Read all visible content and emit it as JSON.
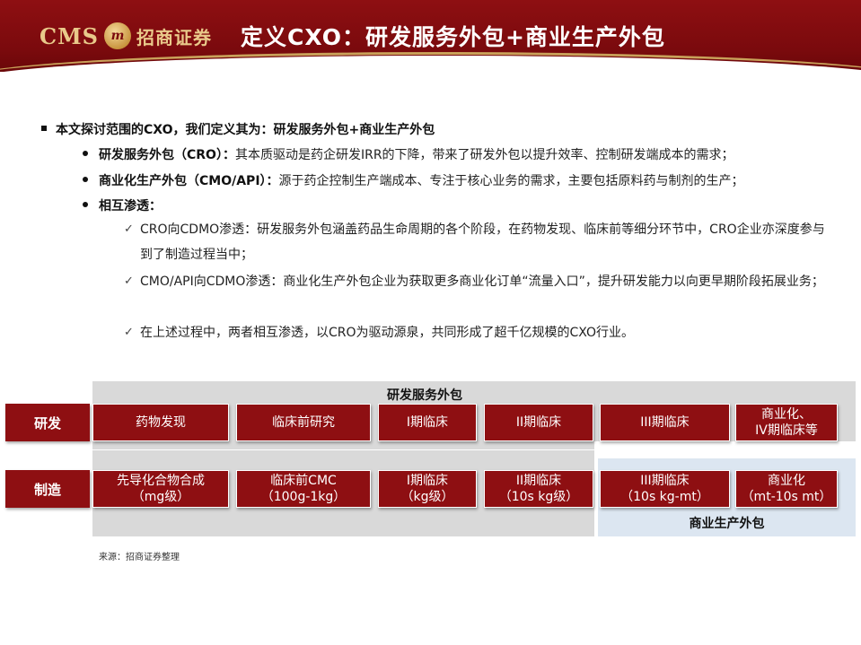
{
  "header": {
    "logo_cms": "CMS",
    "logo_mark": "m",
    "logo_cn": "招商证券",
    "title": "定义CXO：研发服务外包+商业生产外包"
  },
  "bullets": {
    "level1": "本文探讨范围的CXO，我们定义其为：研发服务外包+商业生产外包",
    "items": [
      {
        "bold": "研发服务外包（CRO）：",
        "text": "其本质驱动是药企研发IRR的下降，带来了研发外包以提升效率、控制研发端成本的需求；"
      },
      {
        "bold": "商业化生产外包（CMO/API）：",
        "text": "源于药企控制生产端成本、专注于核心业务的需求，主要包括原料药与制剂的生产；"
      },
      {
        "bold": "相互渗透：",
        "text": ""
      }
    ],
    "sub_items": [
      "CRO向CDMO渗透：研发服务外包涵盖药品生命周期的各个阶段，在药物发现、临床前等细分环节中，CRO企业亦深度参与到了制造过程当中；",
      "CMO/API向CDMO渗透：商业化生产外包企业为获取更多商业化订单“流量入口”，提升研发能力以向更早期阶段拓展业务；",
      "在上述过程中，两者相互渗透，以CRO为驱动源泉，共同形成了超千亿规模的CXO行业。"
    ],
    "check_glyph": "✓"
  },
  "diagram": {
    "rd_band_label": "研发服务外包",
    "mfg_band_label": "商业生产外包",
    "rd_row": {
      "head": "研发",
      "cells": [
        "药物发现",
        "临床前研究",
        "I期临床",
        "II期临床",
        "III期临床",
        "商业化、\nIV期临床等"
      ]
    },
    "mfg_row": {
      "head": "制造",
      "cells": [
        "先导化合物合成\n（mg级）",
        "临床前CMC\n（100g-1kg）",
        "I期临床\n（kg级）",
        "II期临床\n（10s kg级）",
        "III期临床\n（10s kg-mt）",
        "商业化\n（mt-10s mt）"
      ]
    }
  },
  "source": "来源：招商证券整理",
  "colors": {
    "brand_red": "#8e0f12",
    "gold": "#c9a25a",
    "grey_band": "#d9d9d9",
    "blue_band": "#dce6f1"
  }
}
